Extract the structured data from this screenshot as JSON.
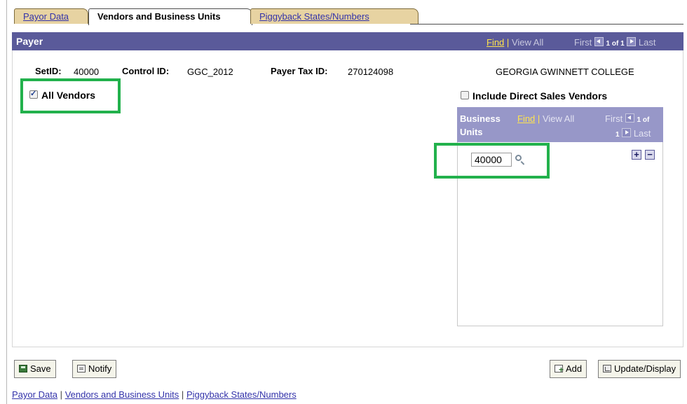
{
  "tabs": [
    {
      "label": "Payor Data",
      "active": false
    },
    {
      "label": "Vendors and Business Units",
      "active": true
    },
    {
      "label": "Piggyback States/Numbers",
      "active": false
    }
  ],
  "payer": {
    "title": "Payer",
    "nav": {
      "find": "Find",
      "sep": "|",
      "view_all": "View All",
      "first": "First",
      "count": "1 of 1",
      "last": "Last"
    },
    "setid_label": "SetID:",
    "setid_value": "40000",
    "control_id_label": "Control ID:",
    "control_id_value": "GGC_2012",
    "tax_id_label": "Payer Tax ID:",
    "tax_id_value": "270124098",
    "college": "GEORGIA GWINNETT COLLEGE",
    "all_vendors_label": "All Vendors",
    "all_vendors_checked": true,
    "direct_sales_label": "Include Direct Sales Vendors",
    "direct_sales_checked": false
  },
  "business_units": {
    "title_line1": "Business",
    "title_line2": "Units",
    "nav": {
      "find": "Find",
      "sep": "|",
      "view_all": "View All",
      "first": "First",
      "count_a": "1 of",
      "count_b": "1",
      "last": "Last"
    },
    "value": "40000",
    "add_row_symbol": "+",
    "delete_row_symbol": "−"
  },
  "buttons": {
    "save": "Save",
    "notify": "Notify",
    "add": "Add",
    "update_display": "Update/Display"
  },
  "footer_links": {
    "payor_data": "Payor Data",
    "vendors": "Vendors and Business Units",
    "piggyback": "Piggyback States/Numbers",
    "sep": "|"
  },
  "colors": {
    "header": "#5a5a9a",
    "grid_header": "#9797c8",
    "tab_inactive": "#e7d3a2",
    "highlight": "#22b14c",
    "find_link": "#ffe44d"
  }
}
